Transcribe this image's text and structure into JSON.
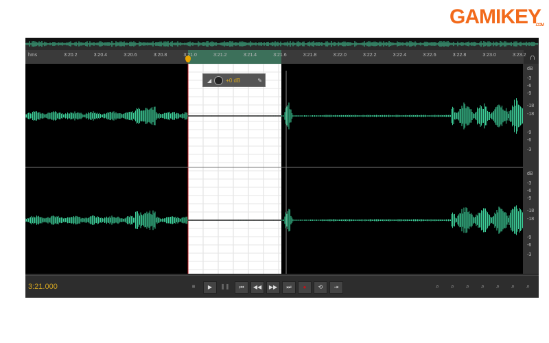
{
  "logo": {
    "text": "GAMIKEY",
    "sub": ".COM"
  },
  "ruler": {
    "unit": "hms",
    "ticks": [
      "3:20.2",
      "3:20.4",
      "3:20.6",
      "3:20.8",
      "3:21.0",
      "3:21.2",
      "3:21.4",
      "3:21.6",
      "3:21.8",
      "3:22.0",
      "3:22.2",
      "3:22.4",
      "3:22.6",
      "3:22.8",
      "3:23.0",
      "3:23.2"
    ]
  },
  "hud": {
    "value": "+0 dB"
  },
  "scale": {
    "labels": [
      "dB",
      "-3",
      "-6",
      "-9",
      "-18",
      "-18",
      "-9",
      "-6",
      "-3"
    ]
  },
  "transport": {
    "time": "3:21.000",
    "buttons": [
      "stop",
      "play",
      "pause",
      "go-to-start",
      "rewind",
      "fast-forward",
      "go-to-end",
      "record",
      "loop",
      "skip-selection"
    ]
  },
  "zoom_buttons": [
    "zoom-in-amplitude",
    "zoom-out-amplitude",
    "zoom-in-time",
    "zoom-out-time",
    "zoom-full",
    "zoom-in-selection",
    "zoom-out-selection"
  ],
  "colors": {
    "waveform": "#3ecf9a",
    "time": "#d4a521",
    "selection": "#ffffff",
    "record": "#c0141a"
  }
}
